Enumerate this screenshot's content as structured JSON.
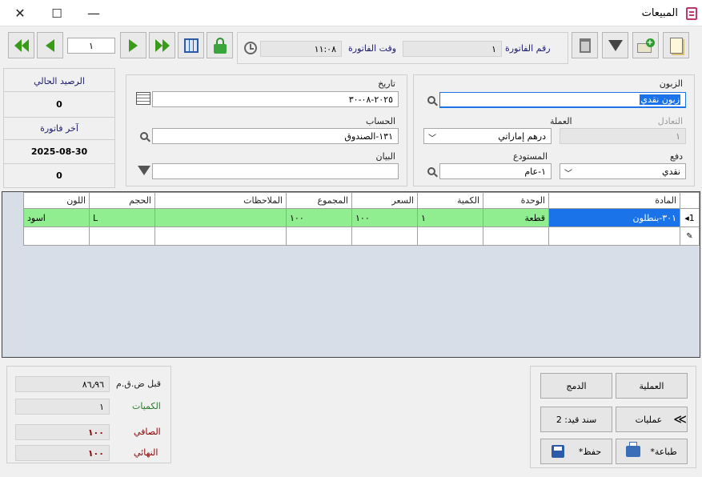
{
  "window": {
    "title": "المبيعات",
    "controls": {
      "close": "✕",
      "maximize": "☐",
      "minimize": "—"
    }
  },
  "toolbar": {
    "invoice_number_label": "رقم الفاتورة",
    "invoice_number": "١",
    "invoice_time_label": "وقت الفاتورة",
    "invoice_time": "١١:٠٨",
    "page_number": "١"
  },
  "side_panel": {
    "balance_label": "الرصيد الحالي",
    "balance_value": "0",
    "last_invoice_label": "آخر فاتورة",
    "last_invoice_date": "2025-08-30",
    "last_invoice_value": "0"
  },
  "form": {
    "customer_label": "الزبون",
    "customer_value": "زبون نقدي",
    "currency_label": "العملة",
    "currency_value": "درهم إماراتي",
    "exchange_label": "التعادل",
    "exchange_value": "١",
    "payment_label": "دفع",
    "payment_value": "نقدي",
    "warehouse_label": "المستودع",
    "warehouse_value": "١-عام",
    "date_label": "تاريخ",
    "date_value": "٢٠٢٥-٠٨-٣٠",
    "account_label": "الحساب",
    "account_value": "١٣١-الصندوق",
    "statement_label": "البيان",
    "statement_value": ""
  },
  "grid": {
    "columns": [
      "المادة",
      "الوحدة",
      "الكمية",
      "السعر",
      "المجموع",
      "الملاحظات",
      "الحجم",
      "اللون"
    ],
    "rows": [
      {
        "marker": "1",
        "item": "٣٠١-بنطلون",
        "unit": "قطعة",
        "qty": "١",
        "price": "١٠٠",
        "total": "١٠٠",
        "notes": "",
        "size": "L",
        "color": "اسود"
      }
    ]
  },
  "totals": {
    "pre_vat_label": "قبل ض.ق.م",
    "pre_vat_value": "٨٦٫٩٦",
    "quantities_label": "الكميات",
    "quantities_value": "١",
    "net_label": "الصافي",
    "net_value": "١٠٠",
    "final_label": "النهائي",
    "final_value": "١٠٠"
  },
  "actions": {
    "operation": "العملية",
    "merge": "الدمج",
    "operations": "عمليات",
    "journal": "سند قيد: 2",
    "print": "طباعة*",
    "save": "حفظ*"
  },
  "colors": {
    "accent": "#1a73e8",
    "row_highlight": "#90ee90",
    "grid_bg": "#d8dee8",
    "label": "#1a1a6e"
  }
}
